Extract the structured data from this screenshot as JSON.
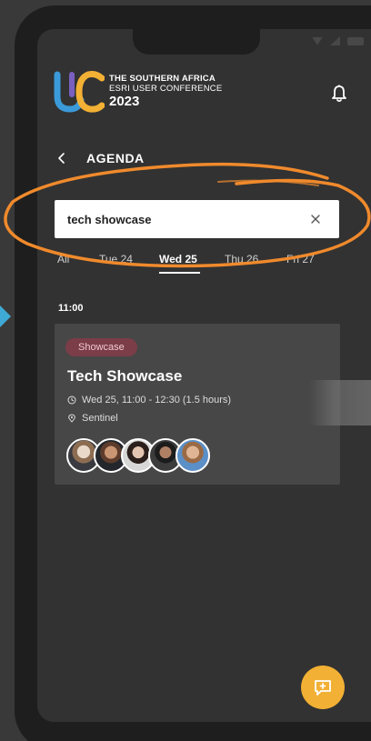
{
  "app": {
    "logo_line1": "THE SOUTHERN AFRICA",
    "logo_line2": "ESRI USER CONFERENCE",
    "logo_year": "2023"
  },
  "nav": {
    "title": "AGENDA"
  },
  "search": {
    "value": "tech showcase"
  },
  "tabs": [
    {
      "label": "All",
      "active": false
    },
    {
      "label": "Tue 24",
      "active": false
    },
    {
      "label": "Wed 25",
      "active": true
    },
    {
      "label": "Thu 26",
      "active": false
    },
    {
      "label": "Fri 27",
      "active": false
    }
  ],
  "schedule": {
    "time": "11:00"
  },
  "session": {
    "badge": "Showcase",
    "title": "Tech Showcase",
    "datetime": "Wed 25, 11:00 - 12:30 (1.5 hours)",
    "location": "Sentinel"
  },
  "icons": {
    "bell": "bell-icon",
    "back": "chevron-left-icon",
    "clear": "close-icon",
    "clock": "clock-icon",
    "location": "pin-icon",
    "fab": "add-message-icon"
  },
  "colors": {
    "background": "#323232",
    "card": "#474747",
    "badge_bg": "#7b3d48",
    "badge_text": "#f0c8cf",
    "accent_orange": "#f2b034",
    "annotation_orange": "#f08a2c",
    "arrow_blue": "#3fa9d6"
  }
}
